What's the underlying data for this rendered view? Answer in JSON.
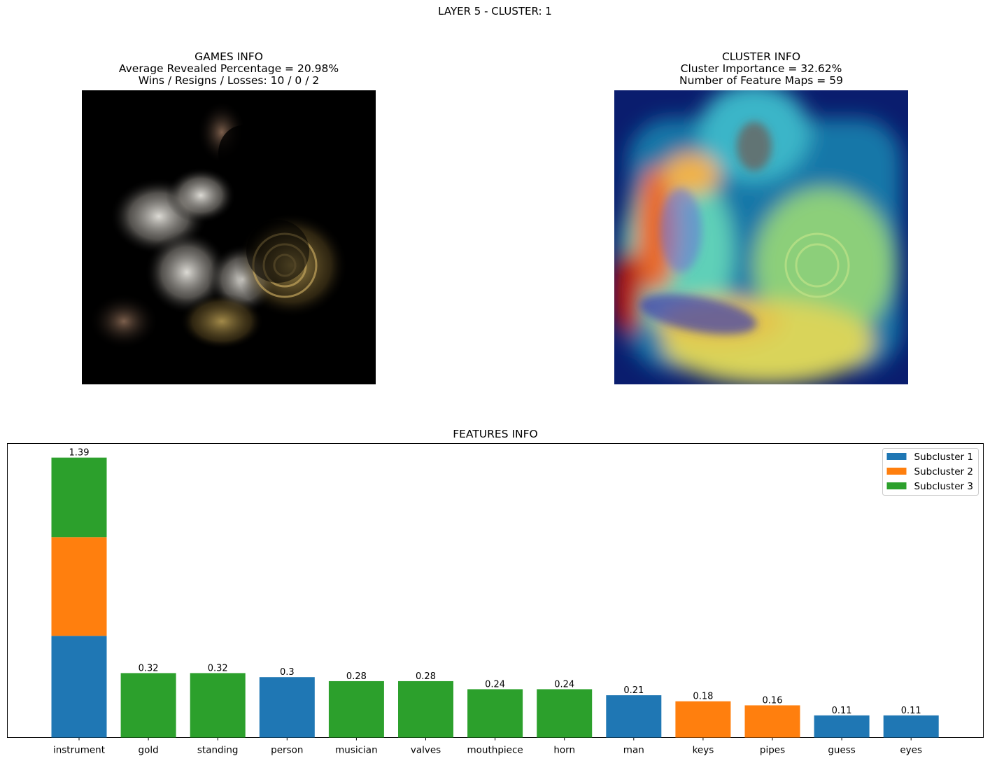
{
  "figure": {
    "suptitle": "LAYER 5 - CLUSTER: 1"
  },
  "games_panel": {
    "title_line1": "GAMES INFO",
    "title_line2": "Average Revealed Percentage = 20.98%",
    "title_line3": "Wins / Resigns / Losses: 10 / 0 / 2"
  },
  "cluster_panel": {
    "title_line1": "CLUSTER INFO",
    "title_line2": "Cluster Importance = 32.62%",
    "title_line3": "Number of Feature Maps = 59"
  },
  "colors": {
    "subcluster_1": "#1f77b4",
    "subcluster_2": "#ff7f0e",
    "subcluster_3": "#2ca02c"
  },
  "chart_data": {
    "type": "bar",
    "title": "FEATURES INFO",
    "xlabel": "",
    "ylabel": "",
    "ylim": [
      0,
      1.46
    ],
    "grid": false,
    "legend_position": "top-right",
    "series": [
      {
        "name": "Subcluster 1",
        "color": "#1f77b4"
      },
      {
        "name": "Subcluster 2",
        "color": "#ff7f0e"
      },
      {
        "name": "Subcluster 3",
        "color": "#2ca02c"
      }
    ],
    "bars": [
      {
        "category": "instrument",
        "label": "1.39",
        "segments": [
          {
            "subcluster": 1,
            "value": 0.505
          },
          {
            "subcluster": 2,
            "value": 0.49
          },
          {
            "subcluster": 3,
            "value": 0.395
          }
        ]
      },
      {
        "category": "gold",
        "label": "0.32",
        "segments": [
          {
            "subcluster": 3,
            "value": 0.32
          }
        ]
      },
      {
        "category": "standing",
        "label": "0.32",
        "segments": [
          {
            "subcluster": 3,
            "value": 0.32
          }
        ]
      },
      {
        "category": "person",
        "label": "0.3",
        "segments": [
          {
            "subcluster": 1,
            "value": 0.3
          }
        ]
      },
      {
        "category": "musician",
        "label": "0.28",
        "segments": [
          {
            "subcluster": 3,
            "value": 0.28
          }
        ]
      },
      {
        "category": "valves",
        "label": "0.28",
        "segments": [
          {
            "subcluster": 3,
            "value": 0.28
          }
        ]
      },
      {
        "category": "mouthpiece",
        "label": "0.24",
        "segments": [
          {
            "subcluster": 3,
            "value": 0.24
          }
        ]
      },
      {
        "category": "horn",
        "label": "0.24",
        "segments": [
          {
            "subcluster": 3,
            "value": 0.24
          }
        ]
      },
      {
        "category": "man",
        "label": "0.21",
        "segments": [
          {
            "subcluster": 1,
            "value": 0.21
          }
        ]
      },
      {
        "category": "keys",
        "label": "0.18",
        "segments": [
          {
            "subcluster": 2,
            "value": 0.18
          }
        ]
      },
      {
        "category": "pipes",
        "label": "0.16",
        "segments": [
          {
            "subcluster": 2,
            "value": 0.16
          }
        ]
      },
      {
        "category": "guess",
        "label": "0.11",
        "segments": [
          {
            "subcluster": 1,
            "value": 0.11
          }
        ]
      },
      {
        "category": "eyes",
        "label": "0.11",
        "segments": [
          {
            "subcluster": 1,
            "value": 0.11
          }
        ]
      }
    ]
  }
}
